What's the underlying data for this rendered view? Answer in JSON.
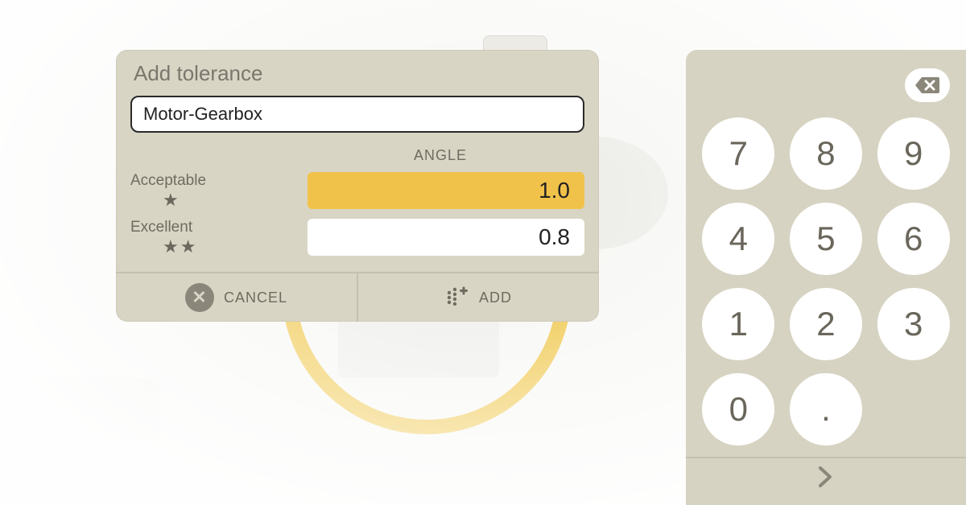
{
  "dialog": {
    "title": "Add tolerance",
    "name_value": "Motor-Gearbox",
    "column_header": "ANGLE",
    "rows": {
      "acceptable": {
        "label": "Acceptable",
        "value": "1.0",
        "stars": 1,
        "active": true
      },
      "excellent": {
        "label": "Excellent",
        "value": "0.8",
        "stars": 2,
        "active": false
      }
    },
    "buttons": {
      "cancel": "CANCEL",
      "add": "ADD"
    }
  },
  "keypad": {
    "keys": [
      "7",
      "8",
      "9",
      "4",
      "5",
      "6",
      "1",
      "2",
      "3",
      "0",
      "."
    ]
  }
}
